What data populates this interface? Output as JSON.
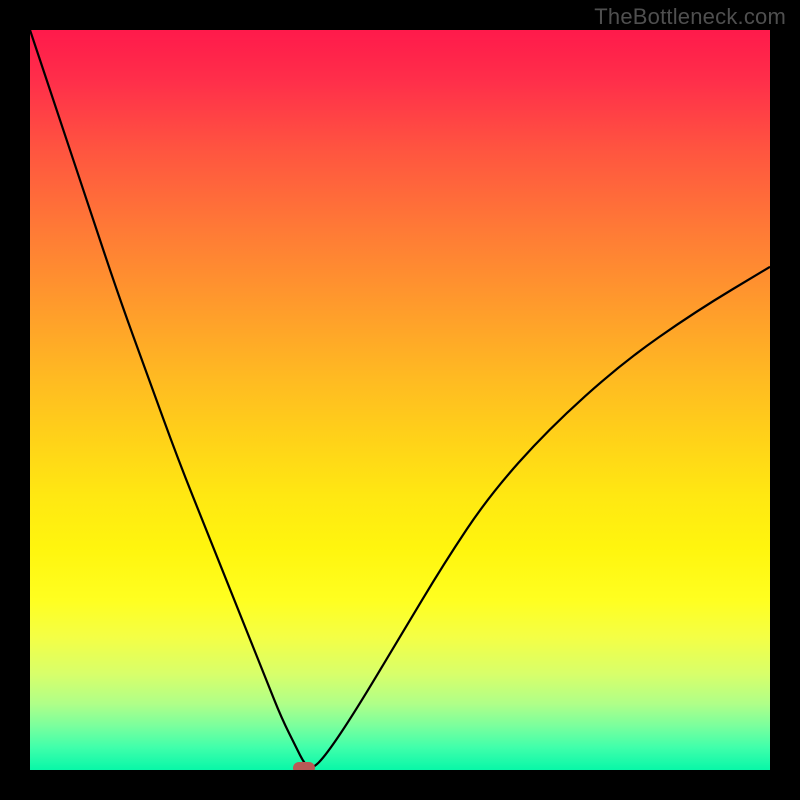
{
  "watermark": "TheBottleneck.com",
  "chart_data": {
    "type": "line",
    "title": "",
    "xlabel": "",
    "ylabel": "",
    "xlim": [
      0,
      100
    ],
    "ylim": [
      0,
      100
    ],
    "x": [
      0,
      4,
      8,
      12,
      16,
      20,
      24,
      28,
      32,
      34,
      36,
      37,
      38,
      40,
      44,
      50,
      56,
      62,
      70,
      80,
      90,
      100
    ],
    "values": [
      100,
      88,
      76,
      64,
      53,
      42,
      32,
      22,
      12,
      7,
      3,
      1,
      0,
      2,
      8,
      18,
      28,
      37,
      46,
      55,
      62,
      68
    ],
    "marker": {
      "x": 37,
      "y": 0
    },
    "gradient_stops": [
      {
        "pos": 0,
        "color": "#ff1a4b"
      },
      {
        "pos": 50,
        "color": "#ffd418"
      },
      {
        "pos": 100,
        "color": "#08f7a8"
      }
    ]
  }
}
